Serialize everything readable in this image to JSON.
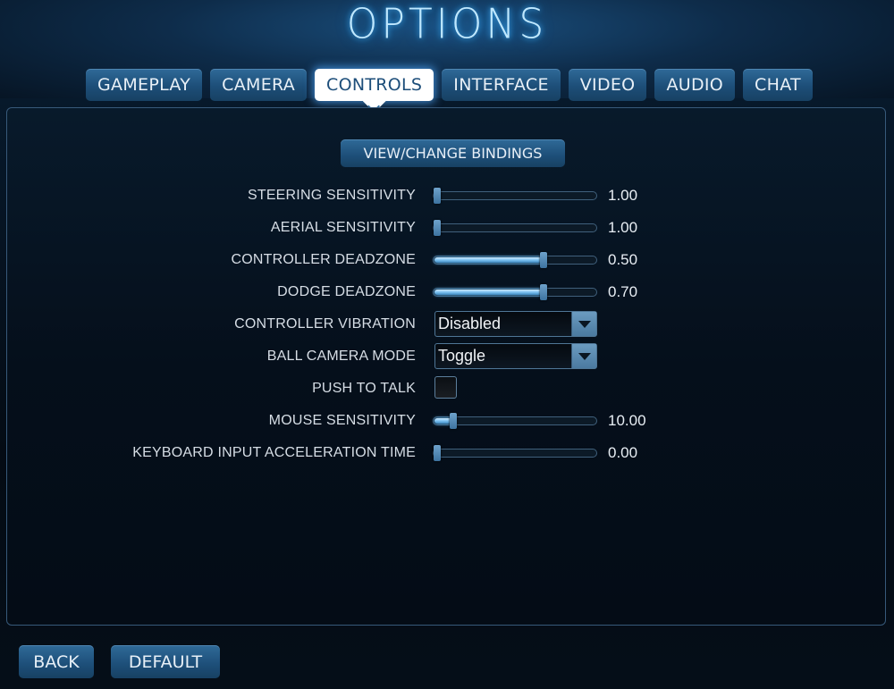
{
  "title": "OPTIONS",
  "tabs": [
    {
      "label": "GAMEPLAY",
      "active": false
    },
    {
      "label": "CAMERA",
      "active": false
    },
    {
      "label": "CONTROLS",
      "active": true
    },
    {
      "label": "INTERFACE",
      "active": false
    },
    {
      "label": "VIDEO",
      "active": false
    },
    {
      "label": "AUDIO",
      "active": false
    },
    {
      "label": "CHAT",
      "active": false
    }
  ],
  "bindings_button": "VIEW/CHANGE BINDINGS",
  "settings": {
    "steering_sensitivity": {
      "label": "STEERING SENSITIVITY",
      "value": "1.00",
      "fill_fraction": 0.0
    },
    "aerial_sensitivity": {
      "label": "AERIAL SENSITIVITY",
      "value": "1.00",
      "fill_fraction": 0.0
    },
    "controller_deadzone": {
      "label": "CONTROLLER DEADZONE",
      "value": "0.50",
      "fill_fraction": 0.67
    },
    "dodge_deadzone": {
      "label": "DODGE DEADZONE",
      "value": "0.70",
      "fill_fraction": 0.67
    },
    "controller_vibration": {
      "label": "CONTROLLER VIBRATION",
      "selected": "Disabled"
    },
    "ball_camera_mode": {
      "label": "BALL CAMERA MODE",
      "selected": "Toggle"
    },
    "push_to_talk": {
      "label": "PUSH TO TALK",
      "checked": false
    },
    "mouse_sensitivity": {
      "label": "MOUSE SENSITIVITY",
      "value": "10.00",
      "fill_fraction": 0.1
    },
    "keyboard_accel_time": {
      "label": "KEYBOARD INPUT ACCELERATION TIME",
      "value": "0.00",
      "fill_fraction": 0.0
    }
  },
  "footer": {
    "back_label": "BACK",
    "default_label": "DEFAULT"
  },
  "colors": {
    "accent_blue": "#1d4e78",
    "active_tab_bg": "#ffffff",
    "glow": "#3fb4ff"
  }
}
